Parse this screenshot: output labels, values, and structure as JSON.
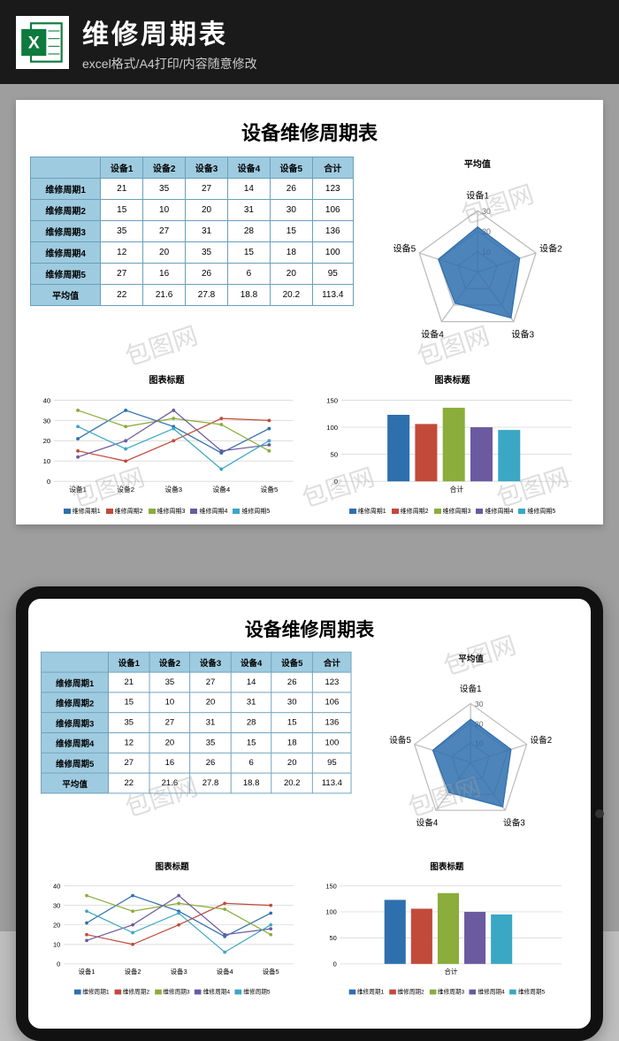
{
  "header": {
    "title": "维修周期表",
    "subtitle": "excel格式/A4打印/内容随意修改"
  },
  "sheet": {
    "main_title": "设备维修周期表",
    "table": {
      "columns": [
        "",
        "设备1",
        "设备2",
        "设备3",
        "设备4",
        "设备5",
        "合计"
      ],
      "rows": [
        {
          "label": "维修周期1",
          "v": [
            "21",
            "35",
            "27",
            "14",
            "26",
            "123"
          ]
        },
        {
          "label": "维修周期2",
          "v": [
            "15",
            "10",
            "20",
            "31",
            "30",
            "106"
          ]
        },
        {
          "label": "维修周期3",
          "v": [
            "35",
            "27",
            "31",
            "28",
            "15",
            "136"
          ]
        },
        {
          "label": "维修周期4",
          "v": [
            "12",
            "20",
            "35",
            "15",
            "18",
            "100"
          ]
        },
        {
          "label": "维修周期5",
          "v": [
            "27",
            "16",
            "26",
            "6",
            "20",
            "95"
          ]
        },
        {
          "label": "平均值",
          "v": [
            "22",
            "21.6",
            "27.8",
            "18.8",
            "20.2",
            "113.4"
          ]
        }
      ]
    },
    "radar": {
      "title": "平均值",
      "axis": [
        "设备1",
        "设备2",
        "设备3",
        "设备4",
        "设备5"
      ],
      "rings": [
        "30",
        "20",
        "10"
      ],
      "values": [
        22,
        21.6,
        27.8,
        18.8,
        20.2
      ]
    },
    "line_chart": {
      "title": "图表标题",
      "ylim": [
        0,
        40
      ],
      "yticks": [
        0,
        10,
        20,
        30,
        40
      ],
      "x": [
        "设备1",
        "设备2",
        "设备3",
        "设备4",
        "设备5"
      ],
      "series": [
        {
          "name": "维修周期1",
          "color": "#2e6fae",
          "v": [
            21,
            35,
            27,
            14,
            26
          ]
        },
        {
          "name": "维修周期2",
          "color": "#c24a3a",
          "v": [
            15,
            10,
            20,
            31,
            30
          ]
        },
        {
          "name": "维修周期3",
          "color": "#8aad3b",
          "v": [
            35,
            27,
            31,
            28,
            15
          ]
        },
        {
          "name": "维修周期4",
          "color": "#6b5aa0",
          "v": [
            12,
            20,
            35,
            15,
            18
          ]
        },
        {
          "name": "维修周期5",
          "color": "#3aa7c4",
          "v": [
            27,
            16,
            26,
            6,
            20
          ]
        }
      ]
    },
    "bar_chart": {
      "title": "图表标题",
      "ylim": [
        0,
        150
      ],
      "yticks": [
        0,
        50,
        100,
        150
      ],
      "xlabel": "合计",
      "series": [
        {
          "name": "维修周期1",
          "color": "#2e6fae",
          "v": 123
        },
        {
          "name": "维修周期2",
          "color": "#c24a3a",
          "v": 106
        },
        {
          "name": "维修周期3",
          "color": "#8aad3b",
          "v": 136
        },
        {
          "name": "维修周期4",
          "color": "#6b5aa0",
          "v": 100
        },
        {
          "name": "维修周期5",
          "color": "#3aa7c4",
          "v": 95
        }
      ]
    }
  },
  "chart_data": [
    {
      "type": "table",
      "title": "设备维修周期表",
      "columns": [
        "设备1",
        "设备2",
        "设备3",
        "设备4",
        "设备5",
        "合计"
      ],
      "rows": {
        "维修周期1": [
          21,
          35,
          27,
          14,
          26,
          123
        ],
        "维修周期2": [
          15,
          10,
          20,
          31,
          30,
          106
        ],
        "维修周期3": [
          35,
          27,
          31,
          28,
          15,
          136
        ],
        "维修周期4": [
          12,
          20,
          35,
          15,
          18,
          100
        ],
        "维修周期5": [
          27,
          16,
          26,
          6,
          20,
          95
        ],
        "平均值": [
          22,
          21.6,
          27.8,
          18.8,
          20.2,
          113.4
        ]
      }
    },
    {
      "type": "line",
      "title": "图表标题",
      "x": [
        "设备1",
        "设备2",
        "设备3",
        "设备4",
        "设备5"
      ],
      "ylim": [
        0,
        40
      ],
      "series": [
        {
          "name": "维修周期1",
          "values": [
            21,
            35,
            27,
            14,
            26
          ]
        },
        {
          "name": "维修周期2",
          "values": [
            15,
            10,
            20,
            31,
            30
          ]
        },
        {
          "name": "维修周期3",
          "values": [
            35,
            27,
            31,
            28,
            15
          ]
        },
        {
          "name": "维修周期4",
          "values": [
            12,
            20,
            35,
            15,
            18
          ]
        },
        {
          "name": "维修周期5",
          "values": [
            27,
            16,
            26,
            6,
            20
          ]
        }
      ]
    },
    {
      "type": "bar",
      "title": "图表标题",
      "categories": [
        "合计"
      ],
      "ylim": [
        0,
        150
      ],
      "series": [
        {
          "name": "维修周期1",
          "values": [
            123
          ]
        },
        {
          "name": "维修周期2",
          "values": [
            106
          ]
        },
        {
          "name": "维修周期3",
          "values": [
            136
          ]
        },
        {
          "name": "维修周期4",
          "values": [
            100
          ]
        },
        {
          "name": "维修周期5",
          "values": [
            95
          ]
        }
      ]
    }
  ],
  "watermark": "包图网"
}
